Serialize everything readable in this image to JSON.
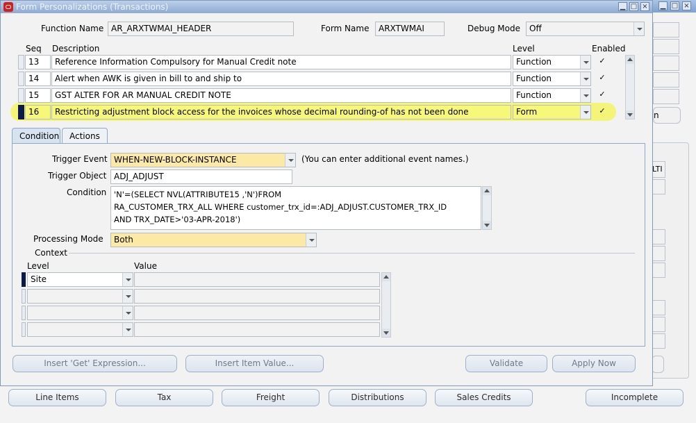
{
  "window": {
    "title": "Form Personalizations (Transactions)",
    "minimize_glyph": "▁",
    "maximize_glyph": "□",
    "close_glyph": "×"
  },
  "header": {
    "function_name_label": "Function Name",
    "function_name_value": "AR_ARXTWMAI_HEADER",
    "form_name_label": "Form Name",
    "form_name_value": "ARXTWMAI",
    "debug_mode_label": "Debug Mode",
    "debug_mode_value": "Off"
  },
  "grid": {
    "columns": {
      "seq": "Seq",
      "description": "Description",
      "level": "Level",
      "enabled": "Enabled"
    },
    "rows": [
      {
        "seq": "13",
        "description": "Reference Information Compulsory for Manual Credit note",
        "level": "Function",
        "enabled": "✓"
      },
      {
        "seq": "14",
        "description": "Alert when AWK is given in bill to and ship to",
        "level": "Function",
        "enabled": "✓"
      },
      {
        "seq": "15",
        "description": "GST ALTER FOR AR MANUAL CREDIT NOTE",
        "level": "Function",
        "enabled": "✓"
      },
      {
        "seq": "16",
        "description": "Restricting adjustment block access for the invoices whose decimal rounding-of has not been done",
        "level": "Form",
        "enabled": "✓"
      }
    ]
  },
  "tabs": {
    "condition": "Condition",
    "actions": "Actions"
  },
  "condition": {
    "trigger_event_label": "Trigger Event",
    "trigger_event_value": "WHEN-NEW-BLOCK-INSTANCE",
    "trigger_event_hint": "(You can enter additional event names.)",
    "trigger_object_label": "Trigger Object",
    "trigger_object_value": "ADJ_ADJUST",
    "condition_label": "Condition",
    "condition_line1": "'N'=(SELECT NVL(ATTRIBUTE15 ,'N')FROM",
    "condition_line2": "RA_CUSTOMER_TRX_ALL WHERE customer_trx_id=:ADJ_ADJUST.CUSTOMER_TRX_ID",
    "condition_line3": "AND TRX_DATE>'03-APR-2018')",
    "processing_mode_label": "Processing Mode",
    "processing_mode_value": "Both",
    "context_label": "Context",
    "context_level_header": "Level",
    "context_value_header": "Value",
    "context_rows": [
      {
        "level": "Site",
        "value": ""
      }
    ]
  },
  "buttons": {
    "insert_get_expression": "Insert 'Get' Expression...",
    "insert_item_value": "Insert Item Value...",
    "validate": "Validate",
    "apply_now": "Apply Now"
  },
  "bottom_buttons": {
    "line_items": "Line Items",
    "tax": "Tax",
    "freight": "Freight",
    "distributions": "Distributions",
    "sales_credits": "Sales Credits",
    "incomplete": "Incomplete"
  },
  "background_fragments": {
    "peek1": "n",
    "peek2": "LTI"
  }
}
